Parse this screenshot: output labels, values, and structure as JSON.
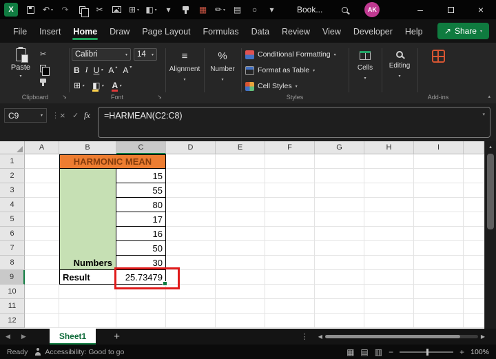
{
  "titlebar": {
    "logo_text": "X",
    "doc_name": "Book...",
    "avatar_initials": "AK",
    "quick_access_icons": [
      {
        "name": "save-icon",
        "cls": "ic-save"
      },
      {
        "name": "undo-icon",
        "glyph": "↶",
        "chevron": true
      },
      {
        "name": "redo-icon",
        "glyph": "↷",
        "dim": true
      },
      {
        "name": "copy-icon",
        "cls": "ic-copy"
      },
      {
        "name": "cut-icon",
        "glyph": "✂"
      },
      {
        "name": "picture-icon",
        "cls": "ic-pic"
      },
      {
        "name": "borders-icon",
        "glyph": "⊞",
        "chevron": true
      },
      {
        "name": "fill-color-icon",
        "glyph": "◧",
        "chevron": true
      },
      {
        "name": "more-commands-icon",
        "glyph": "▾"
      },
      {
        "name": "format-painter-icon",
        "cls": "ic-painter"
      },
      {
        "name": "table-icon",
        "glyph": "▦",
        "color": "#C65342"
      },
      {
        "name": "draw-pen-icon",
        "glyph": "✏",
        "chevron": true
      },
      {
        "name": "calendar-icon",
        "glyph": "▤"
      },
      {
        "name": "record-macro-icon",
        "glyph": "○"
      },
      {
        "name": "customize-toolbar-icon",
        "glyph": "▾"
      }
    ]
  },
  "menu": {
    "items": [
      "File",
      "Insert",
      "Home",
      "Draw",
      "Page Layout",
      "Formulas",
      "Data",
      "Review",
      "View",
      "Developer",
      "Help"
    ],
    "active_index": 2,
    "share_label": "Share"
  },
  "ribbon": {
    "paste_label": "Paste",
    "clipboard_group_label": "Clipboard",
    "font_group_label": "Font",
    "font_name": "Calibri",
    "font_size": "14",
    "bold_label": "B",
    "italic_label": "I",
    "underline_label": "U",
    "grow_font_letter": "A",
    "shrink_font_letter": "A",
    "font_color_letter": "A",
    "alignment_label": "Alignment",
    "number_label": "Number",
    "number_symbol": "%",
    "styles_items": [
      "Conditional Formatting",
      "Format as Table",
      "Cell Styles"
    ],
    "styles_group_label": "Styles",
    "cells_label": "Cells",
    "editing_label": "Editing",
    "addins_label": "Add-ins"
  },
  "formula_bar": {
    "name_box_value": "C9",
    "fx_label": "fx",
    "formula": "=HARMEAN(C2:C8)"
  },
  "grid": {
    "column_headers": [
      "A",
      "B",
      "C",
      "D",
      "E",
      "F",
      "G",
      "H",
      "I"
    ],
    "row_headers": [
      "1",
      "2",
      "3",
      "4",
      "5",
      "6",
      "7",
      "8",
      "9",
      "10",
      "11",
      "12"
    ],
    "selected_column": "C",
    "selected_row": "9",
    "selected_cell": "C9",
    "table": {
      "title": "HARMONIC MEAN",
      "numbers_label": "Numbers",
      "values": [
        "15",
        "55",
        "80",
        "17",
        "16",
        "50",
        "30"
      ],
      "result_label": "Result",
      "result_value": "25.73479"
    }
  },
  "sheet_bar": {
    "tabs": [
      "Sheet1"
    ],
    "active_tab": "Sheet1",
    "new_sheet_label": "+"
  },
  "status_bar": {
    "mode": "Ready",
    "accessibility_text": "Accessibility: Good to go",
    "zoom_out": "−",
    "zoom_in": "+",
    "zoom_level": "100%"
  },
  "colors": {
    "excel_green": "#107C41",
    "accent_green": "#1EA35C",
    "title_fill": "#ED7D31",
    "title_text": "#843C0C",
    "numbers_fill": "#C6E0B4",
    "annotation_red": "#E01B1B",
    "avatar_pink": "#C03991"
  },
  "glyphs": {
    "chevron_down": "▾",
    "chevron_up": "▴",
    "left": "◀",
    "right": "▶",
    "cut": "✂",
    "borders": "⊞",
    "fill": "◧",
    "align": "≡",
    "ellipsis_v": "⋮",
    "cancel": "×",
    "check": "✓",
    "launcher": "↘",
    "minimize": "–",
    "close": "×",
    "share_arrow": "↗",
    "view_normal": "▦",
    "view_layout": "▤",
    "view_break": "▥"
  }
}
